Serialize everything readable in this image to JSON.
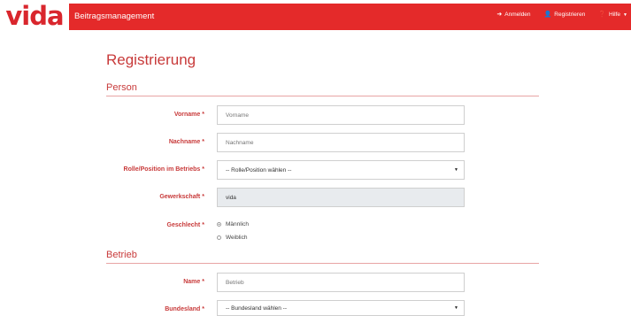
{
  "header": {
    "logo": "vida",
    "app_title": "Beitragsmanagement",
    "nav": [
      {
        "icon": "sign-in-icon",
        "glyph": "➜",
        "label": "Anmelden"
      },
      {
        "icon": "user-icon",
        "glyph": "👤",
        "label": "Registrieren"
      },
      {
        "icon": "help-icon",
        "glyph": "❓",
        "label": "Hilfe"
      }
    ],
    "help_caret": "▼"
  },
  "page": {
    "title": "Registrierung"
  },
  "sections": {
    "person": "Person",
    "betrieb": "Betrieb"
  },
  "form": {
    "required_marker": "*",
    "vorname": {
      "label": "Vorname",
      "placeholder": "Vorname"
    },
    "nachname": {
      "label": "Nachname",
      "placeholder": "Nachname"
    },
    "rolle": {
      "label": "Rolle/Position im Betriebs",
      "selected": "-- Rolle/Position wählen --"
    },
    "gewerkschaft": {
      "label": "Gewerkschaft",
      "value": "vida"
    },
    "geschlecht": {
      "label": "Geschlecht",
      "options": [
        "Männlich",
        "Weiblich"
      ],
      "selected_index": 0
    },
    "betrieb_name": {
      "label": "Name",
      "placeholder": "Betrieb"
    },
    "bundesland": {
      "label": "Bundesland",
      "selected": "-- Bundesland wählen --"
    }
  },
  "colors": {
    "brand_red": "#e42a2a",
    "label_red": "#c83a3a"
  }
}
